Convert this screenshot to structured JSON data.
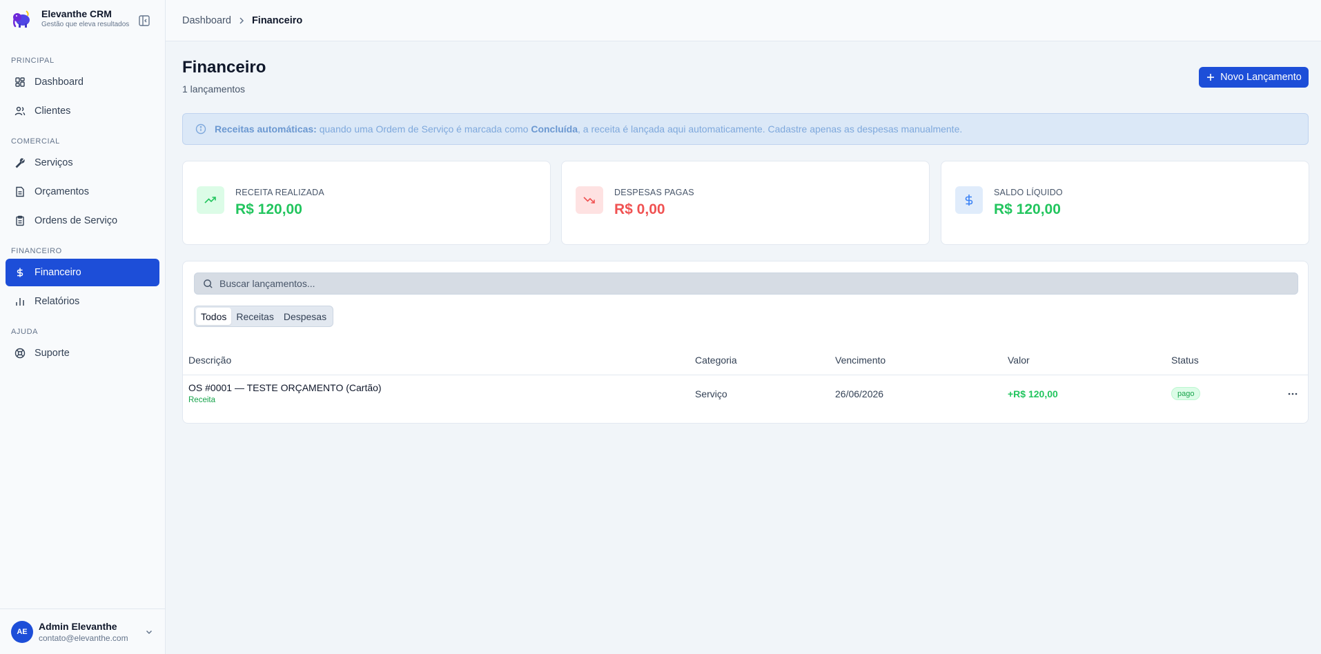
{
  "brand": {
    "name": "Elevanthe CRM",
    "tagline": "Gestão que eleva resultados"
  },
  "sidebar": {
    "sections": [
      {
        "label": "PRINCIPAL"
      },
      {
        "label": "COMERCIAL"
      },
      {
        "label": "FINANCEIRO"
      },
      {
        "label": "AJUDA"
      }
    ],
    "items": [
      {
        "label": "Dashboard",
        "icon": "layout-dashboard-icon"
      },
      {
        "label": "Clientes",
        "icon": "users-icon"
      },
      {
        "label": "Serviços",
        "icon": "wrench-icon"
      },
      {
        "label": "Orçamentos",
        "icon": "file-text-icon"
      },
      {
        "label": "Ordens de Serviço",
        "icon": "clipboard-icon"
      },
      {
        "label": "Financeiro",
        "icon": "dollar-icon",
        "active": true
      },
      {
        "label": "Relatórios",
        "icon": "bar-chart-icon"
      },
      {
        "label": "Suporte",
        "icon": "life-buoy-icon"
      }
    ]
  },
  "user": {
    "initials": "AE",
    "name": "Admin Elevanthe",
    "email": "contato@elevanthe.com"
  },
  "breadcrumb": {
    "root": "Dashboard",
    "current": "Financeiro"
  },
  "page": {
    "title": "Financeiro",
    "subtitle": "1 lançamentos",
    "new_button": "Novo Lançamento"
  },
  "banner": {
    "bold1": "Receitas automáticas:",
    "text1": " quando uma Ordem de Serviço é marcada como ",
    "bold2": "Concluída",
    "text2": ", a receita é lançada aqui automaticamente. Cadastre apenas as despesas manualmente."
  },
  "stats": [
    {
      "label": "RECEITA REALIZADA",
      "value": "R$ 120,00",
      "color": "#22c55e"
    },
    {
      "label": "DESPESAS PAGAS",
      "value": "R$ 0,00",
      "color": "#f05252"
    },
    {
      "label": "SALDO LÍQUIDO",
      "value": "R$ 120,00",
      "color": "#22c55e"
    }
  ],
  "search": {
    "placeholder": "Buscar lançamentos..."
  },
  "filters": [
    "Todos",
    "Receitas",
    "Despesas"
  ],
  "table": {
    "headers": [
      "Descrição",
      "Categoria",
      "Vencimento",
      "Valor",
      "Status"
    ],
    "rows": [
      {
        "description": "OS #0001 — TESTE ORÇAMENTO (Cartão)",
        "type": "Receita",
        "category": "Serviço",
        "due": "26/06/2026",
        "value": "+R$ 120,00",
        "status": "pago"
      }
    ]
  }
}
